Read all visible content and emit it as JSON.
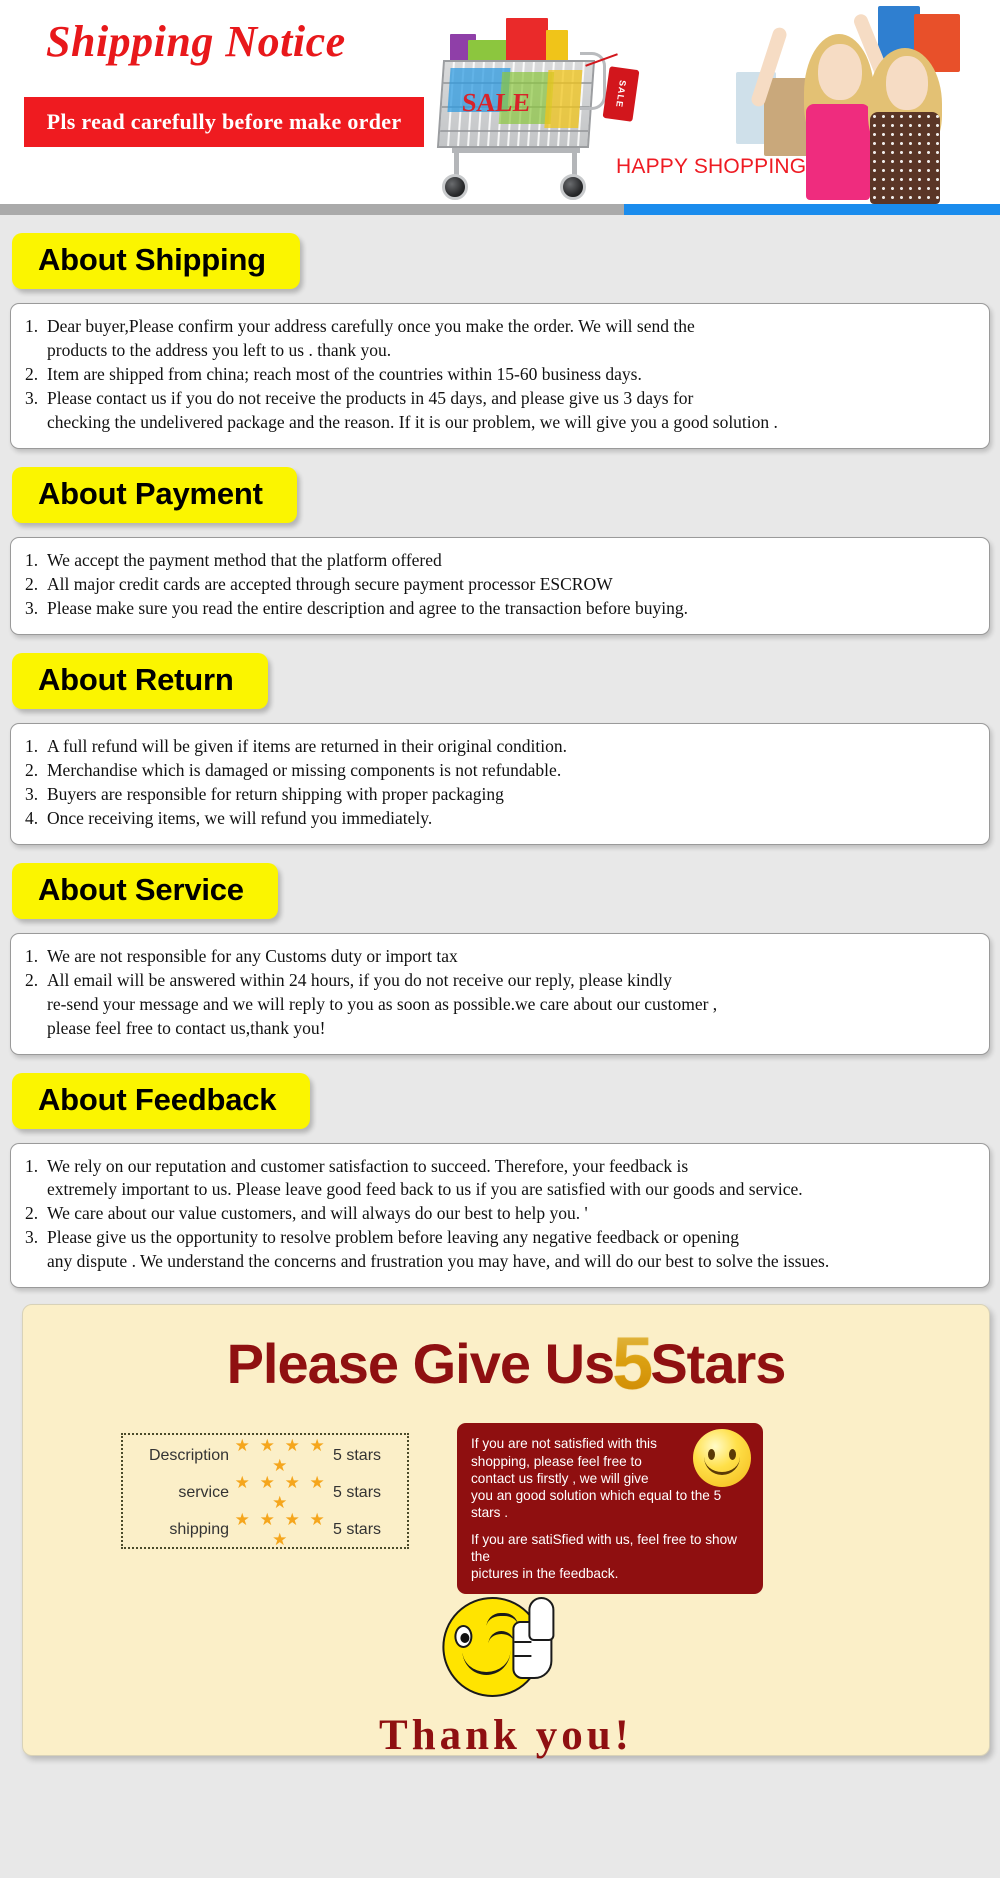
{
  "banner": {
    "title": "Shipping Notice",
    "subtitle": "Pls read carefully before make order",
    "happy_shopping": "HAPPY SHOPPING",
    "sale_tag": "SALE",
    "accent_red": "#e8181b",
    "accent_yellow": "#fbf500",
    "accent_blue": "#1a8ced",
    "accent_grey": "#aaaaaa"
  },
  "sections": [
    {
      "tab": "About Shipping",
      "items": [
        "Dear buyer,Please confirm your address carefully once you make the order. We will send the\nproducts to the address you left to us . thank you.",
        "Item are shipped from china; reach most of the countries within 15-60 business days.",
        "Please contact us if you do not receive the products in 45 days, and please give us 3 days for\nchecking the undelivered package and the reason. If it is our problem, we will give you a good solution ."
      ]
    },
    {
      "tab": "About Payment",
      "items": [
        "We accept the payment method that the platform offered",
        "All major credit cards are accepted through secure payment processor ESCROW",
        "Please make sure you read the entire description and agree to the transaction before buying."
      ]
    },
    {
      "tab": "About Return",
      "items": [
        "A full refund will be given if items are returned in their original condition.",
        "Merchandise which is damaged or missing components is not refundable.",
        "Buyers are responsible for return shipping with proper packaging",
        "Once receiving items, we will refund you immediately."
      ]
    },
    {
      "tab": "About Service",
      "items": [
        "We are not responsible for any Customs duty or import tax",
        "All email will be answered within 24 hours, if you do not receive our reply, please kindly\nre-send your message and we will reply to you as soon as possible.we care about our customer ,\nplease feel free to contact us,thank you!"
      ]
    },
    {
      "tab": "About Feedback",
      "items": [
        "We rely on our reputation and customer satisfaction to succeed. Therefore, your feedback is\nextremely important to us. Please leave good feed back to us if you are satisfied with our goods and service.",
        "We care about our value customers, and will always do our best to help you. '",
        "Please give us the opportunity to resolve problem before leaving any negative feedback or opening\nany dispute . We understand the concerns and frustration you may have, and will do our best to solve the issues."
      ]
    }
  ],
  "stars_panel": {
    "headline_before": "Please Give Us",
    "headline_number": "5",
    "headline_after": "Stars",
    "ratings": [
      {
        "label": "Description",
        "stars": "★ ★ ★ ★ ★",
        "value": "5 stars"
      },
      {
        "label": "service",
        "stars": "★ ★ ★ ★ ★",
        "value": "5 stars"
      },
      {
        "label": "shipping",
        "stars": "★ ★ ★ ★ ★",
        "value": "5 stars"
      }
    ],
    "red_note_1": "If you are not satisfied with this\nshopping, please feel free to\ncontact us firstly , we will give\nyou an good solution which equal to the 5 stars .",
    "red_note_2": "If you are satiSfied with us, feel free to show the\npictures in the feedback.",
    "thank_you": "Thank you!"
  }
}
